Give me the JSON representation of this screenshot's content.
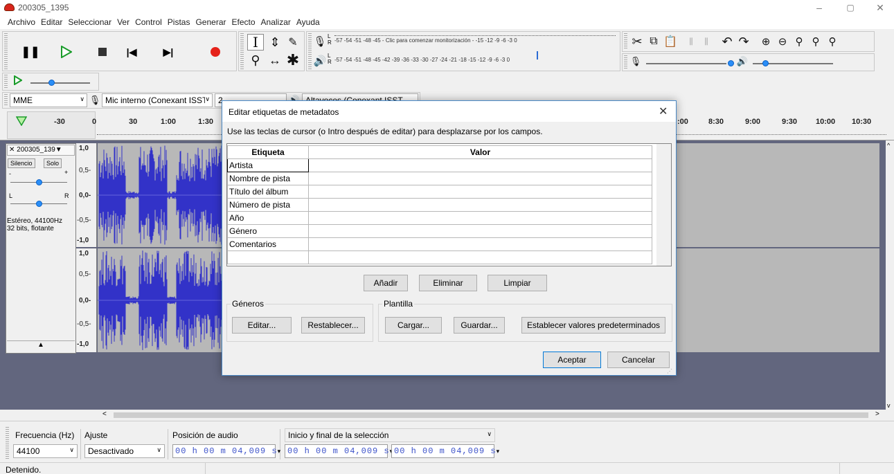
{
  "window": {
    "title": "200305_1395",
    "controls": [
      "–",
      "▢",
      "✕"
    ]
  },
  "menu": [
    "Archivo",
    "Editar",
    "Seleccionar",
    "Ver",
    "Control",
    "Pistas",
    "Generar",
    "Efecto",
    "Analizar",
    "Ayuda"
  ],
  "meters": {
    "record_scale": "-57 -54 -51 -48 -45 - Clic para comenzar monitorización - -15 -12  -9  -6  -3  0",
    "play_scale": "-57 -54 -51 -48 -45 -42 -39 -36 -33 -30 -27 -24 -21 -18 -15 -12  -9  -6  -3  0",
    "L": "L",
    "R": "R"
  },
  "devices": {
    "host": "MME",
    "input": "Mic interno (Conexant ISST",
    "channels": "2",
    "output": "Altavoces (Conexant ISST"
  },
  "timeline": {
    "left_ticks": [
      "-30",
      "0",
      "30",
      "1:00",
      "1:30"
    ],
    "right_ticks": [
      ":00",
      "8:30",
      "9:00",
      "9:30",
      "10:00",
      "10:30"
    ]
  },
  "track": {
    "name": "200305_139▼",
    "mute": "Silencio",
    "solo": "Solo",
    "gain_minus": "-",
    "gain_plus": "+",
    "pan_L": "L",
    "pan_R": "R",
    "info1": "Estéreo, 44100Hz",
    "info2": "32 bits, flotante",
    "ruler": [
      "1,0",
      "0,5-",
      "0,0-",
      "-0,5-",
      "-1,0"
    ]
  },
  "dialog": {
    "title": "Editar etiquetas de metadatos",
    "instructions": "Use las teclas de cursor (o Intro después de editar) para desplazarse por los campos.",
    "col_tag": "Etiqueta",
    "col_value": "Valor",
    "rows": [
      "Artista",
      "Nombre de pista",
      "Título del álbum",
      "Número de pista",
      "Año",
      "Género",
      "Comentarios",
      ""
    ],
    "add": "Añadir",
    "remove": "Eliminar",
    "clear": "Limpiar",
    "genres_group": "Géneros",
    "genres_edit": "Editar...",
    "genres_reset": "Restablecer...",
    "template_group": "Plantilla",
    "load": "Cargar...",
    "save": "Guardar...",
    "set_default": "Establecer valores predeterminados",
    "ok": "Aceptar",
    "cancel": "Cancelar"
  },
  "selection": {
    "rate_label": "Frecuencia (Hz)",
    "snap_label": "Ajuste",
    "pos_label": "Posición de audio",
    "sel_label": "Inicio y final de la selección",
    "rate_value": "44100",
    "snap_value": "Desactivado",
    "pos_value": "00 h 00 m 04,009 s",
    "sel_start": "00 h 00 m 04,009 s",
    "sel_end": "00 h 00 m 04,009 s"
  },
  "status": "Detenido."
}
